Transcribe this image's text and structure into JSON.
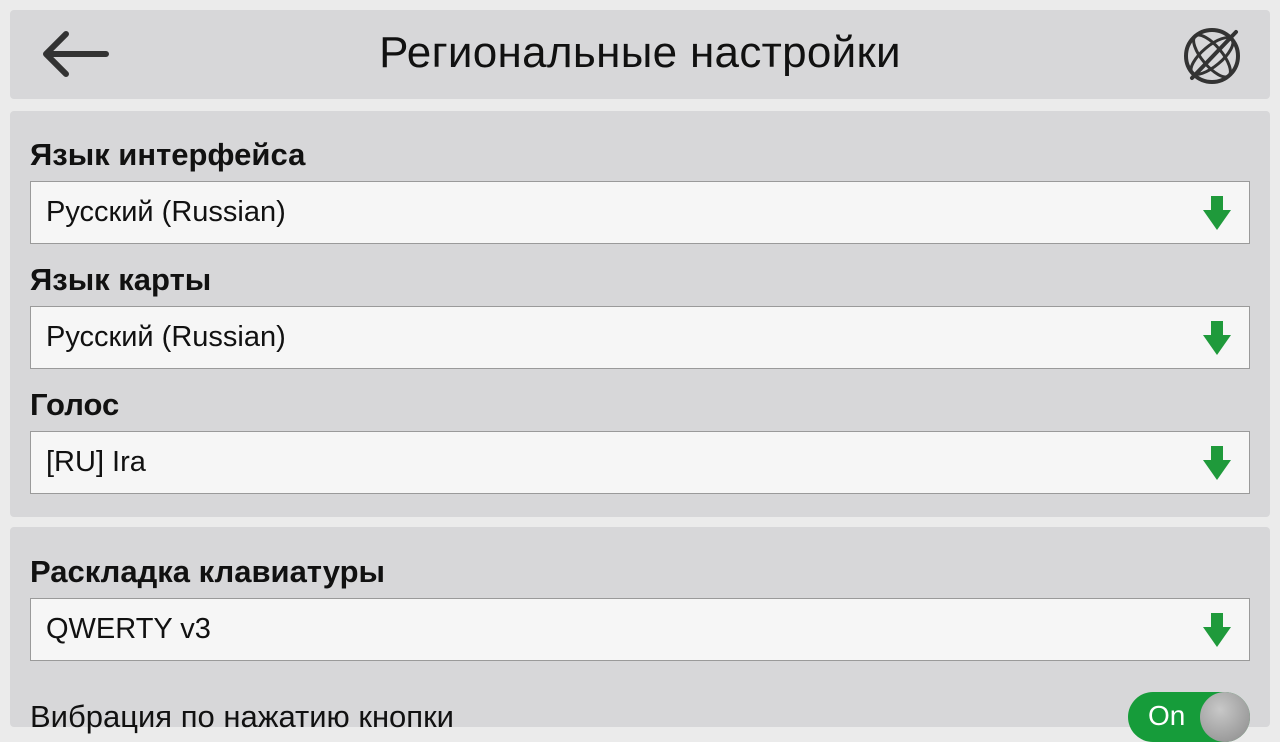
{
  "header": {
    "title": "Региональные настройки",
    "back_icon": "arrow-left-icon",
    "map_icon": "crossed-globe-icon"
  },
  "settings": {
    "interface_language": {
      "label": "Язык интерфейса",
      "value": "Русский (Russian)"
    },
    "map_language": {
      "label": "Язык карты",
      "value": "Русский (Russian)"
    },
    "voice": {
      "label": "Голос",
      "value": "[RU] Ira"
    },
    "keyboard_layout": {
      "label": "Раскладка клавиатуры",
      "value": "QWERTY v3"
    },
    "vibration": {
      "label": "Вибрация по нажатию кнопки",
      "toggle_text": "On",
      "enabled": true
    }
  },
  "colors": {
    "accent_green": "#169c3a",
    "panel_bg": "#d7d7d9",
    "page_bg": "#ebebeb"
  }
}
